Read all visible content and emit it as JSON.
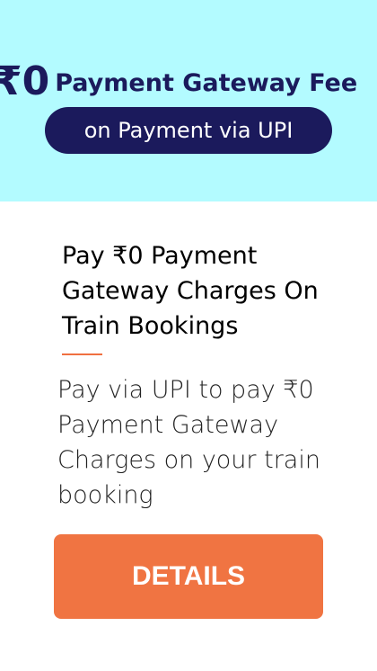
{
  "banner": {
    "headline_symbol": "₹0",
    "headline_text": "Payment Gateway Fee",
    "pill_text": "on Payment via UPI",
    "background_color": "#b3fbff",
    "accent_color": "#1b1a5c"
  },
  "content": {
    "title": "Pay ₹0 Payment Gateway Charges On Train Bookings",
    "description": "Pay via UPI to pay ₹0 Payment Gateway Charges on your train booking"
  },
  "button": {
    "label": "DETAILS",
    "color": "#f07442"
  }
}
